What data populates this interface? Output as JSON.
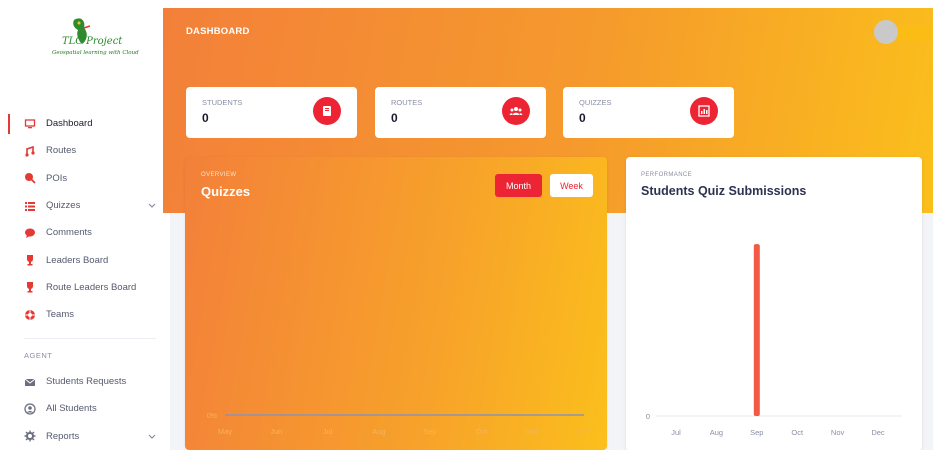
{
  "logo": {
    "title": "TLC Project",
    "subtitle": "Geospatial learning with Cloud"
  },
  "header": {
    "title": "DASHBOARD"
  },
  "sidebar": {
    "items": [
      {
        "label": "Dashboard",
        "icon": "monitor-icon"
      },
      {
        "label": "Routes",
        "icon": "route-icon"
      },
      {
        "label": "POIs",
        "icon": "poi-icon"
      },
      {
        "label": "Quizzes",
        "icon": "list-icon"
      },
      {
        "label": "Comments",
        "icon": "comment-icon"
      },
      {
        "label": "Leaders Board",
        "icon": "trophy-icon"
      },
      {
        "label": "Route Leaders Board",
        "icon": "trophy-icon"
      },
      {
        "label": "Teams",
        "icon": "lifebuoy-icon"
      }
    ],
    "section": "AGENT",
    "agent_items": [
      {
        "label": "Students Requests",
        "icon": "mail-icon"
      },
      {
        "label": "All Students",
        "icon": "user-icon"
      },
      {
        "label": "Reports",
        "icon": "gear-icon"
      }
    ]
  },
  "stats": [
    {
      "label": "STUDENTS",
      "value": "0",
      "icon": "book-icon"
    },
    {
      "label": "ROUTES",
      "value": "0",
      "icon": "users-icon"
    },
    {
      "label": "QUIZZES",
      "value": "0",
      "icon": "chart-icon"
    }
  ],
  "overview": {
    "subtitle": "OVERVIEW",
    "title": "Quizzes",
    "month_label": "Month",
    "week_label": "Week"
  },
  "performance": {
    "subtitle": "PERFORMANCE",
    "title": "Students Quiz Submissions"
  },
  "colors": {
    "accent": "#ec2433",
    "gradient_start": "#f3803a",
    "gradient_end": "#fbbf1c",
    "bar": "#f15a45"
  },
  "chart_data": [
    {
      "type": "line",
      "categories": [
        "May",
        "Jun",
        "Jul",
        "Aug",
        "Sep",
        "Oct",
        "Nov",
        "Dec"
      ],
      "series": [
        {
          "values": [
            0,
            0,
            0,
            0,
            0,
            0,
            0,
            0
          ]
        }
      ],
      "ytick_labels": [
        "0%"
      ],
      "ylim": [
        0,
        100
      ],
      "grid": false
    },
    {
      "type": "bar",
      "categories": [
        "Jul",
        "Aug",
        "Sep",
        "Oct",
        "Nov",
        "Dec"
      ],
      "values": [
        0,
        0,
        1,
        0,
        0,
        0
      ],
      "ytick_labels": [
        "0"
      ],
      "ylim": [
        0,
        1.1
      ],
      "grid": false
    }
  ]
}
